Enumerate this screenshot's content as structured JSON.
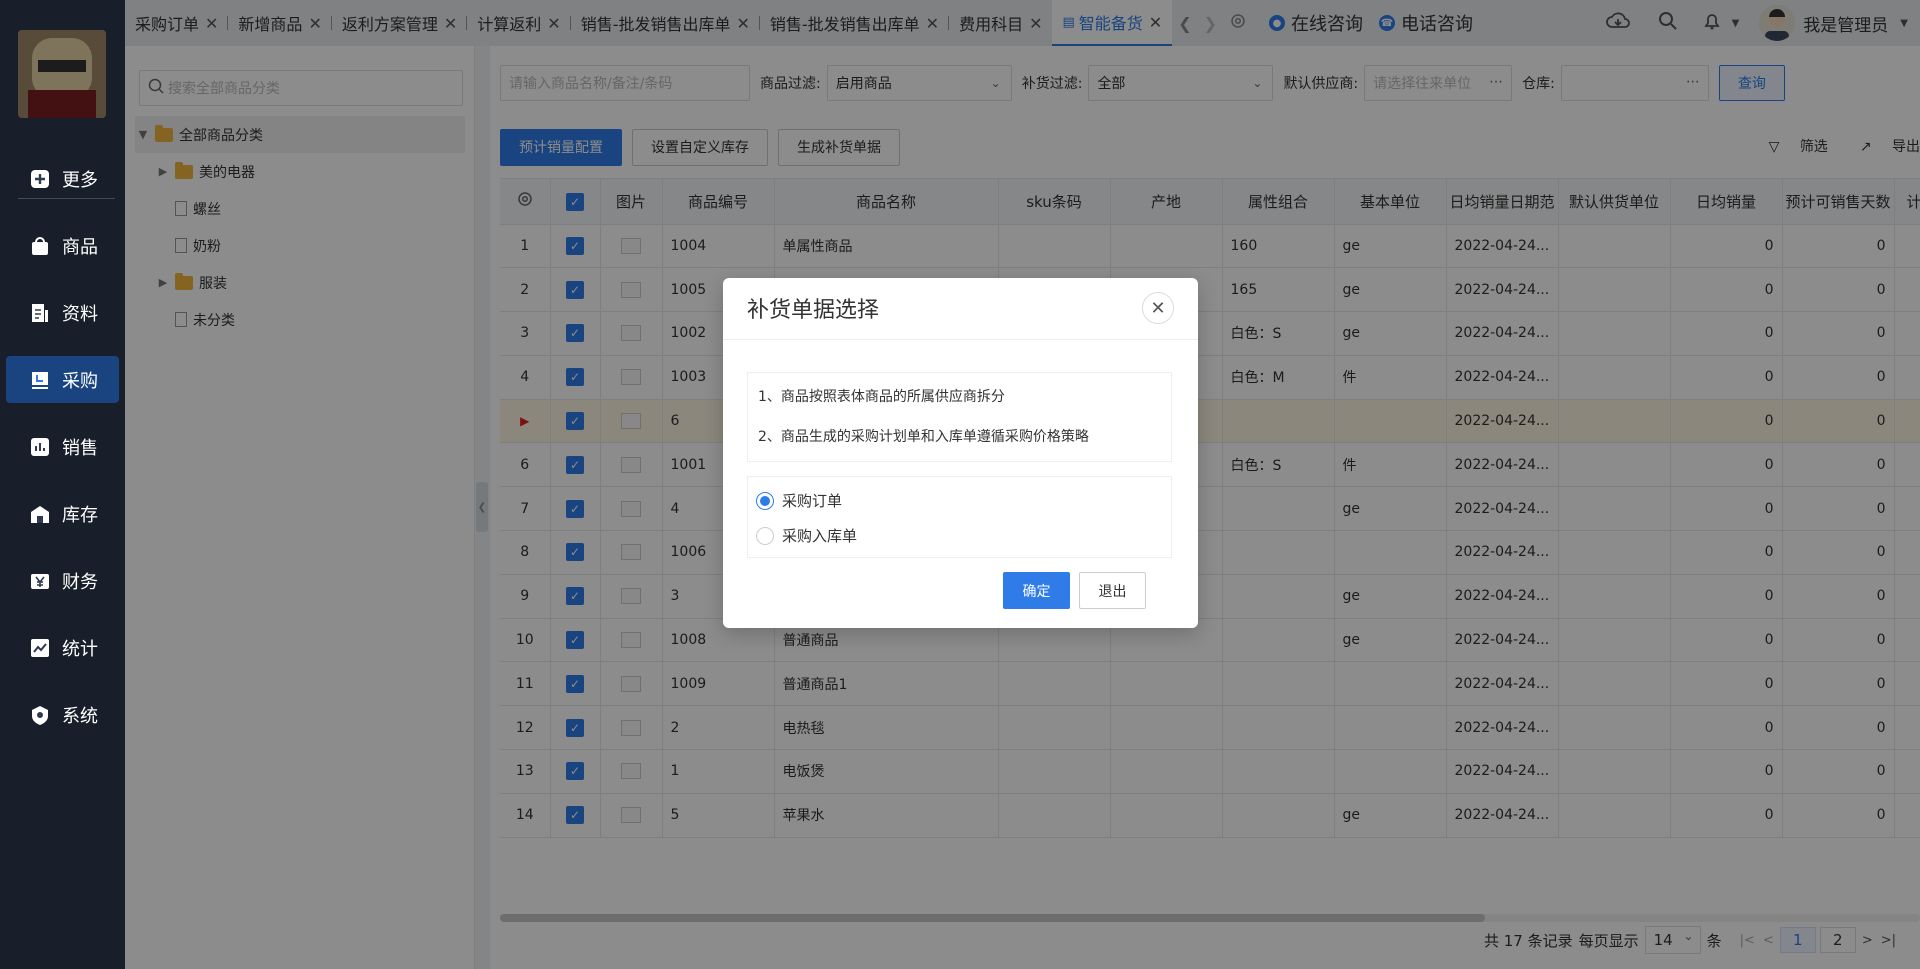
{
  "sidebar": {
    "items": [
      {
        "label": "更多",
        "icon": "plus-square-icon",
        "active": false
      },
      {
        "label": "商品",
        "icon": "bag-icon",
        "active": false
      },
      {
        "label": "资料",
        "icon": "file-chart-icon",
        "active": false
      },
      {
        "label": "采购",
        "icon": "purchase-icon",
        "active": true
      },
      {
        "label": "销售",
        "icon": "bar-chart-icon",
        "active": false
      },
      {
        "label": "库存",
        "icon": "warehouse-icon",
        "active": false
      },
      {
        "label": "财务",
        "icon": "yen-icon",
        "active": false
      },
      {
        "label": "统计",
        "icon": "trend-chart-icon",
        "active": false
      },
      {
        "label": "系统",
        "icon": "shield-icon",
        "active": false
      }
    ]
  },
  "tabs": [
    {
      "label": "采购订单"
    },
    {
      "label": "新增商品"
    },
    {
      "label": "返利方案管理"
    },
    {
      "label": "计算返利"
    },
    {
      "label": "销售-批发销售出库单"
    },
    {
      "label": "销售-批发销售出库单"
    },
    {
      "label": "费用科目"
    },
    {
      "label": "智能备货",
      "active": true
    }
  ],
  "topbar": {
    "online_consult": "在线咨询",
    "phone_consult": "电话咨询",
    "user_name": "我是管理员"
  },
  "tree": {
    "search_placeholder": "搜索全部商品分类",
    "root": "全部商品分类",
    "nodes": [
      {
        "label": "美的电器",
        "type": "folder"
      },
      {
        "label": "螺丝",
        "type": "file"
      },
      {
        "label": "奶粉",
        "type": "file"
      },
      {
        "label": "服装",
        "type": "folder"
      },
      {
        "label": "未分类",
        "type": "file"
      }
    ]
  },
  "filters": {
    "search_placeholder": "请输入商品名称/备注/条码",
    "product_filter_label": "商品过滤:",
    "product_filter_value": "启用商品",
    "replenish_filter_label": "补货过滤:",
    "replenish_filter_value": "全部",
    "supplier_label": "默认供应商:",
    "supplier_placeholder": "请选择往来单位",
    "warehouse_label": "仓库:",
    "query_button": "查询"
  },
  "actions": {
    "forecast_config": "预计销量配置",
    "custom_stock": "设置自定义库存",
    "generate_bill": "生成补货单据",
    "filter": "筛选",
    "export": "导出"
  },
  "table": {
    "columns": [
      "图片",
      "商品编号",
      "商品名称",
      "sku条码",
      "产地",
      "属性组合",
      "基本单位",
      "日均销量日期范",
      "默认供货单位",
      "日均销量",
      "预计可销售天数",
      "计"
    ],
    "rows": [
      {
        "idx": "1",
        "code": "1004",
        "name": "单属性商品",
        "sku": "",
        "origin": "",
        "attr": "160",
        "unit": "ge",
        "date": "2022-04-24...",
        "supply": "",
        "daily": "0",
        "days": "0"
      },
      {
        "idx": "2",
        "code": "1005",
        "name": "",
        "sku": "",
        "origin": "",
        "attr": "165",
        "unit": "ge",
        "date": "2022-04-24...",
        "supply": "",
        "daily": "0",
        "days": "0"
      },
      {
        "idx": "3",
        "code": "1002",
        "name": "",
        "sku": "",
        "origin": "",
        "attr": "白色：S",
        "unit": "ge",
        "date": "2022-04-24...",
        "supply": "",
        "daily": "0",
        "days": "0"
      },
      {
        "idx": "4",
        "code": "1003",
        "name": "",
        "sku": "",
        "origin": "",
        "attr": "白色：M",
        "unit": "件",
        "date": "2022-04-24...",
        "supply": "",
        "daily": "0",
        "days": "0"
      },
      {
        "idx": "",
        "code": "6",
        "name": "",
        "sku": "",
        "origin": "",
        "attr": "",
        "unit": "",
        "date": "2022-04-24...",
        "supply": "",
        "daily": "0",
        "days": "0",
        "current": true
      },
      {
        "idx": "6",
        "code": "1001",
        "name": "",
        "sku": "",
        "origin": "",
        "attr": "白色：S",
        "unit": "件",
        "date": "2022-04-24...",
        "supply": "",
        "daily": "0",
        "days": "0"
      },
      {
        "idx": "7",
        "code": "4",
        "name": "",
        "sku": "",
        "origin": "",
        "attr": "",
        "unit": "ge",
        "date": "2022-04-24...",
        "supply": "",
        "daily": "0",
        "days": "0"
      },
      {
        "idx": "8",
        "code": "1006",
        "name": "",
        "sku": "",
        "origin": "",
        "attr": "",
        "unit": "",
        "date": "2022-04-24...",
        "supply": "",
        "daily": "0",
        "days": "0"
      },
      {
        "idx": "9",
        "code": "3",
        "name": "",
        "sku": "",
        "origin": "",
        "attr": "",
        "unit": "ge",
        "date": "2022-04-24...",
        "supply": "",
        "daily": "0",
        "days": "0"
      },
      {
        "idx": "10",
        "code": "1008",
        "name": "普通商品",
        "sku": "",
        "origin": "",
        "attr": "",
        "unit": "ge",
        "date": "2022-04-24...",
        "supply": "",
        "daily": "0",
        "days": "0"
      },
      {
        "idx": "11",
        "code": "1009",
        "name": "普通商品1",
        "sku": "",
        "origin": "",
        "attr": "",
        "unit": "",
        "date": "2022-04-24...",
        "supply": "",
        "daily": "0",
        "days": "0"
      },
      {
        "idx": "12",
        "code": "2",
        "name": "电热毯",
        "sku": "",
        "origin": "",
        "attr": "",
        "unit": "",
        "date": "2022-04-24...",
        "supply": "",
        "daily": "0",
        "days": "0"
      },
      {
        "idx": "13",
        "code": "1",
        "name": "电饭煲",
        "sku": "",
        "origin": "",
        "attr": "",
        "unit": "",
        "date": "2022-04-24...",
        "supply": "",
        "daily": "0",
        "days": "0"
      },
      {
        "idx": "14",
        "code": "5",
        "name": "苹果水",
        "sku": "",
        "origin": "",
        "attr": "",
        "unit": "ge",
        "date": "2022-04-24...",
        "supply": "",
        "daily": "0",
        "days": "0"
      }
    ]
  },
  "pager": {
    "total_text": "共 17 条记录",
    "per_page_label": "每页显示",
    "per_page_value": "14",
    "per_page_unit": "条",
    "pages": [
      "1",
      "2"
    ],
    "current": "1"
  },
  "modal": {
    "title": "补货单据选择",
    "note1": "1、商品按照表体商品的所属供应商拆分",
    "note2": "2、商品生成的采购计划单和入库单遵循采购价格策略",
    "option1": "采购订单",
    "option2": "采购入库单",
    "selected": "采购订单",
    "confirm": "确定",
    "cancel": "退出"
  },
  "colors": {
    "accent": "#2f7ce8",
    "sidebar_bg": "#2d3a4f",
    "highlight_row": "#fdf6e3"
  }
}
